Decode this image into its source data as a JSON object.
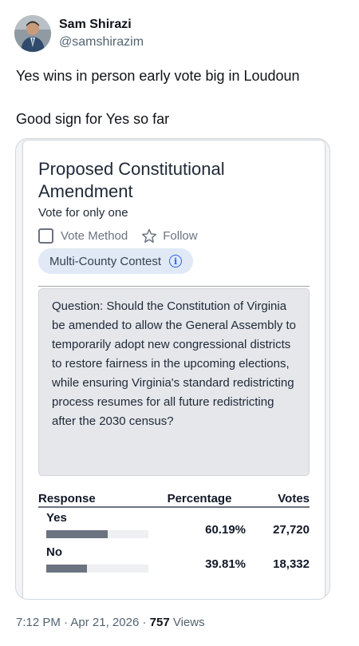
{
  "author": {
    "display_name": "Sam Shirazi",
    "handle": "@samshirazim"
  },
  "tweet": {
    "line1": "Yes wins in person early vote big in Loudoun",
    "line2": "Good sign for Yes so far"
  },
  "ballot": {
    "title": "Proposed Constitutional Amendment",
    "instruction": "Vote for only one",
    "vote_method_label": "Vote Method",
    "follow_label": "Follow",
    "contest_pill": "Multi-County Contest",
    "info_glyph": "i",
    "question": "Question: Should the Constitution of Virginia be amended to allow the General Assembly to temporarily adopt new congressional districts to restore fairness in the upcoming elections, while ensuring Virginia's standard redistricting process resumes for all future redistricting after the 2030 census?",
    "columns": {
      "response": "Response",
      "percentage": "Percentage",
      "votes": "Votes"
    },
    "rows": [
      {
        "label": "Yes",
        "percentage": "60.19%",
        "votes": "27,720",
        "share": 0.6019
      },
      {
        "label": "No",
        "percentage": "39.81%",
        "votes": "18,332",
        "share": 0.3981
      }
    ],
    "colors": {
      "pill_bg": "#e0e9f5",
      "bar": "#6b7280",
      "info": "#2563eb"
    }
  },
  "meta": {
    "time": "7:12 PM",
    "separator": "·",
    "date": "Apr 21, 2026",
    "views_count": "757",
    "views_label": "Views"
  }
}
